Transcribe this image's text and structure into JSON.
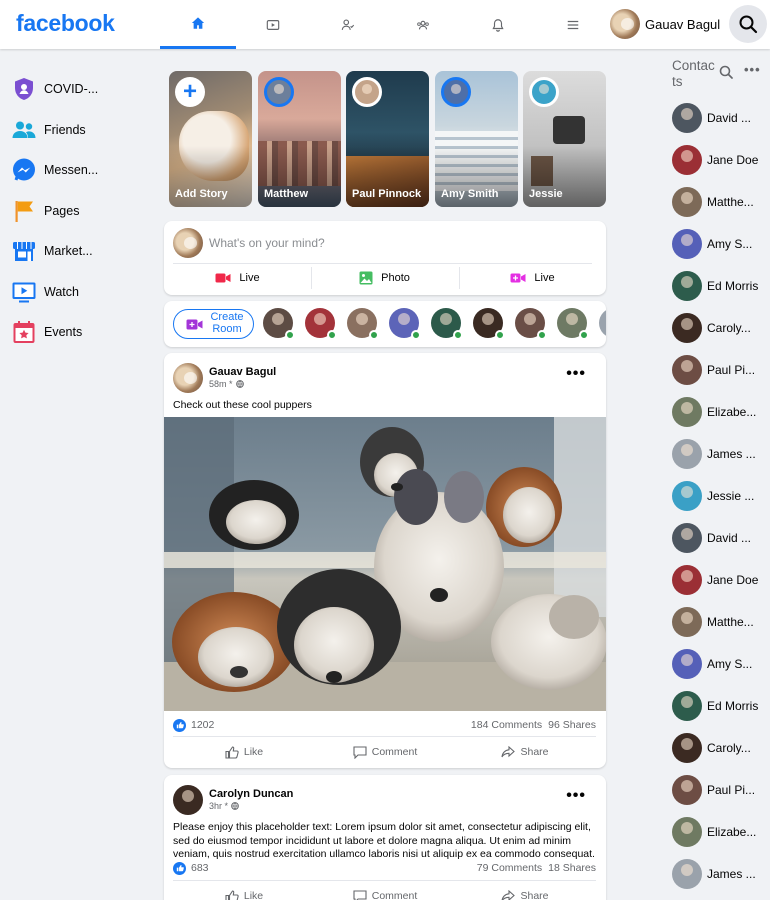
{
  "brand": {
    "logo": "facebook",
    "accent": "#1877f2"
  },
  "header": {
    "tabs": [
      {
        "name": "home",
        "active": true
      },
      {
        "name": "watch",
        "active": false
      },
      {
        "name": "friends",
        "active": false
      },
      {
        "name": "groups",
        "active": false
      },
      {
        "name": "notifications",
        "active": false
      },
      {
        "name": "menu",
        "active": false
      }
    ],
    "profile_name": "Gauav Bagul"
  },
  "sidebar": {
    "items": [
      {
        "label": "COVID-...",
        "icon": "shield-icon"
      },
      {
        "label": "Friends",
        "icon": "friends-icon"
      },
      {
        "label": "Messen...",
        "icon": "messenger-icon"
      },
      {
        "label": "Pages",
        "icon": "flag-icon"
      },
      {
        "label": "Market...",
        "icon": "store-icon"
      },
      {
        "label": "Watch",
        "icon": "tv-icon"
      },
      {
        "label": "Events",
        "icon": "calendar-icon"
      }
    ]
  },
  "stories": [
    {
      "label": "Add Story"
    },
    {
      "label": "Matthew"
    },
    {
      "label": "Paul Pinnock"
    },
    {
      "label": "Amy Smith"
    },
    {
      "label": "Jessie"
    }
  ],
  "composer": {
    "placeholder": "What's on your mind?",
    "actions": [
      {
        "label": "Live",
        "icon": "video-icon",
        "color": "#f02849"
      },
      {
        "label": "Photo",
        "icon": "photo-icon",
        "color": "#45bd62"
      },
      {
        "label": "Live",
        "icon": "video-icon",
        "color": "#e42fe3"
      }
    ]
  },
  "rooms": {
    "create_label": "Create Room"
  },
  "posts": [
    {
      "author": "Gauav Bagul",
      "meta": "58m *",
      "text": "Check out these cool puppers",
      "likes": "1202",
      "comments": "184 Comments",
      "shares": "96 Shares",
      "actions": {
        "like": "Like",
        "comment": "Comment",
        "share": "Share"
      }
    },
    {
      "author": "Carolyn Duncan",
      "meta": "3hr *",
      "text": "Please enjoy this placeholder text: Lorem ipsum dolor sit amet, consectetur adipiscing elit, sed do eiusmod tempor incididunt ut labore et dolore magna aliqua. Ut enim ad minim veniam, quis nostrud exercitation ullamco laboris nisi ut aliquip ex ea commodo consequat.",
      "likes": "683",
      "comments": "79 Comments",
      "shares": "18 Shares",
      "actions": {
        "like": "Like",
        "comment": "Comment",
        "share": "Share"
      }
    }
  ],
  "contacts": {
    "title": "Contacts",
    "items": [
      "David ...",
      "Jane Doe",
      "Matthe...",
      "Amy S...",
      "Ed Morris",
      "Caroly...",
      "Paul Pi...",
      "Elizabe...",
      "James ...",
      "Jessie ...",
      "David ...",
      "Jane Doe",
      "Matthe...",
      "Amy S...",
      "Ed Morris",
      "Caroly...",
      "Paul Pi...",
      "Elizabe...",
      "James ..."
    ]
  }
}
